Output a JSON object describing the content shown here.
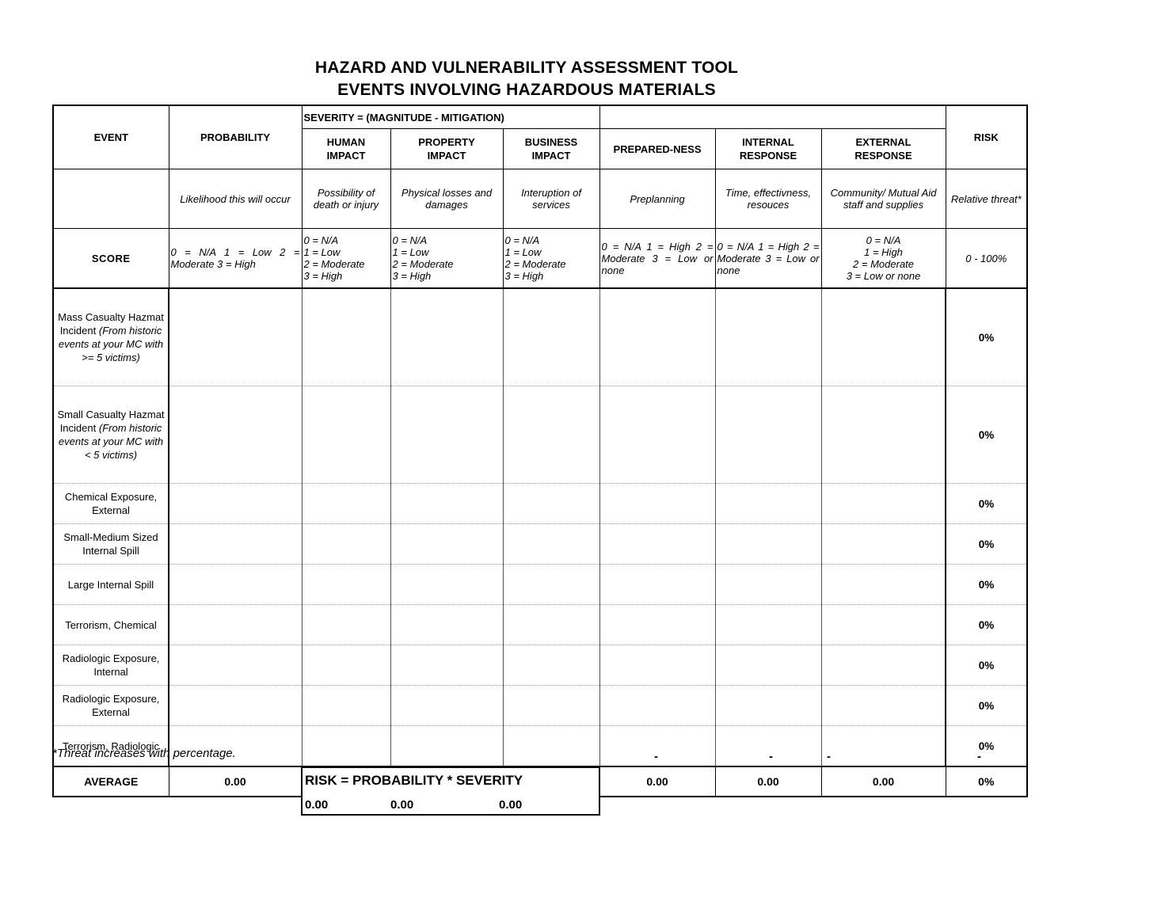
{
  "title": {
    "line1": "HAZARD AND VULNERABILITY ASSESSMENT TOOL",
    "line2": "EVENTS INVOLVING HAZARDOUS MATERIALS"
  },
  "headers": {
    "event": "EVENT",
    "probability": "PROBABILITY",
    "severity_span": "SEVERITY = (MAGNITUDE - MITIGATION)",
    "severity_span_empty": "",
    "human_impact": "HUMAN\nIMPACT",
    "human_impact_l1": "HUMAN",
    "human_impact_l2": "IMPACT",
    "property_impact_l1": "PROPERTY",
    "property_impact_l2": "IMPACT",
    "business_impact_l1": "BUSINESS",
    "business_impact_l2": "IMPACT",
    "preparedness": "PREPARED-NESS",
    "internal_response_l1": "INTERNAL",
    "internal_response_l2": "RESPONSE",
    "external_response_l1": "EXTERNAL",
    "external_response_l2": "RESPONSE",
    "risk": "RISK"
  },
  "descriptions": {
    "probability": "Likelihood this will occur",
    "human_impact": "Possibility of death or injury",
    "property_impact": "Physical losses and damages",
    "business_impact": "Interuption of services",
    "preparedness": "Preplanning",
    "internal_response": "Time, effectivness, resouces",
    "external_response": "Community/ Mutual Aid staff and supplies",
    "risk": "Relative threat*"
  },
  "score_row": {
    "label": "SCORE",
    "probability": "0 = N/A     1 = Low     2 = Moderate     3 = High",
    "human_impact": "0 = N/A\n1 = Low\n2 = Moderate\n3 = High",
    "property_impact": "0 = N/A\n1 = Low\n2 = Moderate\n3 = High",
    "business_impact": "0 = N/A\n1 = Low\n2 = Moderate\n3 = High",
    "preparedness": "0 = N/A     1 = High     2 = Moderate     3 = Low or none",
    "internal_response": "0 = N/A     1 = High     2 = Moderate     3 = Low or none",
    "external_response": "0 = N/A\n1 = High\n2 = Moderate\n3 = Low or none",
    "risk": "0 - 100%"
  },
  "events": [
    {
      "name": "Mass Casualty Hazmat Incident",
      "note": "(From historic events at your MC with >= 5 victims)",
      "probability": "",
      "human_impact": "",
      "property_impact": "",
      "business_impact": "",
      "preparedness": "",
      "internal_response": "",
      "external_response": "",
      "risk": "0%"
    },
    {
      "name": "Small Casualty Hazmat Incident",
      "note": "(From historic events at your MC with < 5 victims)",
      "probability": "",
      "human_impact": "",
      "property_impact": "",
      "business_impact": "",
      "preparedness": "",
      "internal_response": "",
      "external_response": "",
      "risk": "0%"
    },
    {
      "name": "Chemical Exposure, External",
      "note": "",
      "probability": "",
      "human_impact": "",
      "property_impact": "",
      "business_impact": "",
      "preparedness": "",
      "internal_response": "",
      "external_response": "",
      "risk": "0%"
    },
    {
      "name": "Small-Medium Sized Internal Spill",
      "note": "",
      "probability": "",
      "human_impact": "",
      "property_impact": "",
      "business_impact": "",
      "preparedness": "",
      "internal_response": "",
      "external_response": "",
      "risk": "0%"
    },
    {
      "name": "Large Internal Spill",
      "note": "",
      "probability": "",
      "human_impact": "",
      "property_impact": "",
      "business_impact": "",
      "preparedness": "",
      "internal_response": "",
      "external_response": "",
      "risk": "0%"
    },
    {
      "name": "Terrorism, Chemical",
      "note": "",
      "probability": "",
      "human_impact": "",
      "property_impact": "",
      "business_impact": "",
      "preparedness": "",
      "internal_response": "",
      "external_response": "",
      "risk": "0%"
    },
    {
      "name": "Radiologic Exposure, Internal",
      "note": "",
      "probability": "",
      "human_impact": "",
      "property_impact": "",
      "business_impact": "",
      "preparedness": "",
      "internal_response": "",
      "external_response": "",
      "risk": "0%"
    },
    {
      "name": "Radiologic Exposure, External",
      "note": "",
      "probability": "",
      "human_impact": "",
      "property_impact": "",
      "business_impact": "",
      "preparedness": "",
      "internal_response": "",
      "external_response": "",
      "risk": "0%"
    },
    {
      "name": "Terrorism, Radiologic",
      "note": "",
      "probability": "",
      "human_impact": "",
      "property_impact": "",
      "business_impact": "",
      "preparedness": "",
      "internal_response": "",
      "external_response": "",
      "risk": "0%"
    }
  ],
  "average_row": {
    "label": "AVERAGE",
    "probability": "0.00",
    "human_impact": "0.00",
    "property_impact": "0.00",
    "business_impact": "0.00",
    "preparedness": "0.00",
    "internal_response": "0.00",
    "external_response": "0.00",
    "risk": "0%"
  },
  "footnote": "*Threat increases with percentage.",
  "dashes": [
    "-",
    "-",
    "-",
    "-"
  ],
  "formula": {
    "title": "RISK  =  PROBABILITY * SEVERITY",
    "v0": "0.00",
    "v1": "0.00",
    "v2": "0.00"
  },
  "colors": {
    "cyan": "#CCF7F7",
    "orange": "#FBC894",
    "green": "#C9F2C9",
    "yellow": "#FAFA8C",
    "average_risk": "#F79A1E"
  }
}
